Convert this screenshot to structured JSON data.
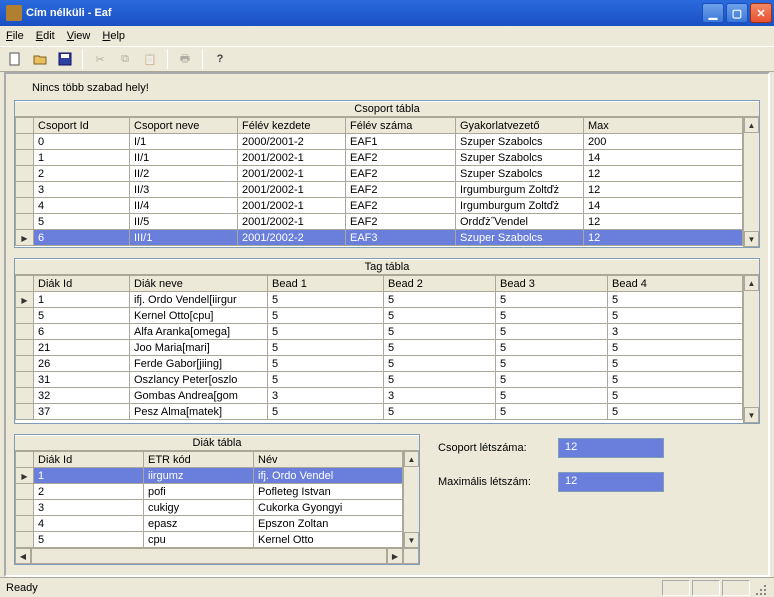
{
  "window": {
    "title": "Cím nélküli - Eaf"
  },
  "menu": {
    "file": "File",
    "edit": "Edit",
    "view": "View",
    "help": "Help"
  },
  "status_msg": "Nincs több szabad hely!",
  "status_bar": "Ready",
  "csoport": {
    "title": "Csoport tábla",
    "headers": [
      "Csoport Id",
      "Csoport neve",
      "Félév kezdete",
      "Félév száma",
      "Gyakorlatvezető",
      "Max"
    ],
    "rows": [
      {
        "id": "0",
        "nev": "I/1",
        "kezd": "2000/2001-2",
        "szam": "EAF1",
        "vez": "Szuper Szabolcs",
        "max": "200",
        "sel": false,
        "ptr": false
      },
      {
        "id": "1",
        "nev": "II/1",
        "kezd": "2001/2002-1",
        "szam": "EAF2",
        "vez": "Szuper Szabolcs",
        "max": "14",
        "sel": false,
        "ptr": false
      },
      {
        "id": "2",
        "nev": "II/2",
        "kezd": "2001/2002-1",
        "szam": "EAF2",
        "vez": "Szuper Szabolcs",
        "max": "12",
        "sel": false,
        "ptr": false
      },
      {
        "id": "3",
        "nev": "II/3",
        "kezd": "2001/2002-1",
        "szam": "EAF2",
        "vez": "Irgumburgum Zoltďż",
        "max": "12",
        "sel": false,
        "ptr": false
      },
      {
        "id": "4",
        "nev": "II/4",
        "kezd": "2001/2002-1",
        "szam": "EAF2",
        "vez": "Irgumburgum Zoltďż",
        "max": "14",
        "sel": false,
        "ptr": false
      },
      {
        "id": "5",
        "nev": "II/5",
        "kezd": "2001/2002-1",
        "szam": "EAF2",
        "vez": "Ordďż˝Vendel",
        "max": "12",
        "sel": false,
        "ptr": false
      },
      {
        "id": "6",
        "nev": "III/1",
        "kezd": "2001/2002-2",
        "szam": "EAF3",
        "vez": "Szuper Szabolcs",
        "max": "12",
        "sel": true,
        "ptr": true
      }
    ]
  },
  "tag": {
    "title": "Tag tábla",
    "headers": [
      "Diák Id",
      "Diák neve",
      "Bead 1",
      "Bead 2",
      "Bead 3",
      "Bead 4"
    ],
    "rows": [
      {
        "id": "1",
        "nev": "ifj. Ordo Vendel[iirgur",
        "b1": "5",
        "b2": "5",
        "b3": "5",
        "b4": "5",
        "ptr": true
      },
      {
        "id": "5",
        "nev": "Kernel Otto[cpu]",
        "b1": "5",
        "b2": "5",
        "b3": "5",
        "b4": "5",
        "ptr": false
      },
      {
        "id": "6",
        "nev": "Alfa Aranka[omega]",
        "b1": "5",
        "b2": "5",
        "b3": "5",
        "b4": "3",
        "ptr": false
      },
      {
        "id": "21",
        "nev": "Joo Maria[mari]",
        "b1": "5",
        "b2": "5",
        "b3": "5",
        "b4": "5",
        "ptr": false
      },
      {
        "id": "26",
        "nev": "Ferde Gabor[jiing]",
        "b1": "5",
        "b2": "5",
        "b3": "5",
        "b4": "5",
        "ptr": false
      },
      {
        "id": "31",
        "nev": "Oszlancy Peter[oszlo",
        "b1": "5",
        "b2": "5",
        "b3": "5",
        "b4": "5",
        "ptr": false
      },
      {
        "id": "32",
        "nev": "Gombas Andrea[gom",
        "b1": "3",
        "b2": "3",
        "b3": "5",
        "b4": "5",
        "ptr": false
      },
      {
        "id": "37",
        "nev": "Pesz Alma[matek]",
        "b1": "5",
        "b2": "5",
        "b3": "5",
        "b4": "5",
        "ptr": false
      }
    ]
  },
  "diak": {
    "title": "Diák tábla",
    "headers": [
      "Diák Id",
      "ETR kód",
      "Név"
    ],
    "rows": [
      {
        "id": "1",
        "etr": "iirgumz",
        "nev": "ifj. Ordo Vendel",
        "sel": true,
        "ptr": true
      },
      {
        "id": "2",
        "etr": "pofi",
        "nev": "Pofleteg Istvan",
        "sel": false,
        "ptr": false
      },
      {
        "id": "3",
        "etr": "cukigy",
        "nev": "Cukorka Gyongyi",
        "sel": false,
        "ptr": false
      },
      {
        "id": "4",
        "etr": "epasz",
        "nev": "Epszon Zoltan",
        "sel": false,
        "ptr": false
      },
      {
        "id": "5",
        "etr": "cpu",
        "nev": "Kernel Otto",
        "sel": false,
        "ptr": false
      }
    ]
  },
  "form": {
    "letszam_label": "Csoport létszáma:",
    "letszam_value": "12",
    "max_label": "Maximális létszám:",
    "max_value": "12"
  }
}
